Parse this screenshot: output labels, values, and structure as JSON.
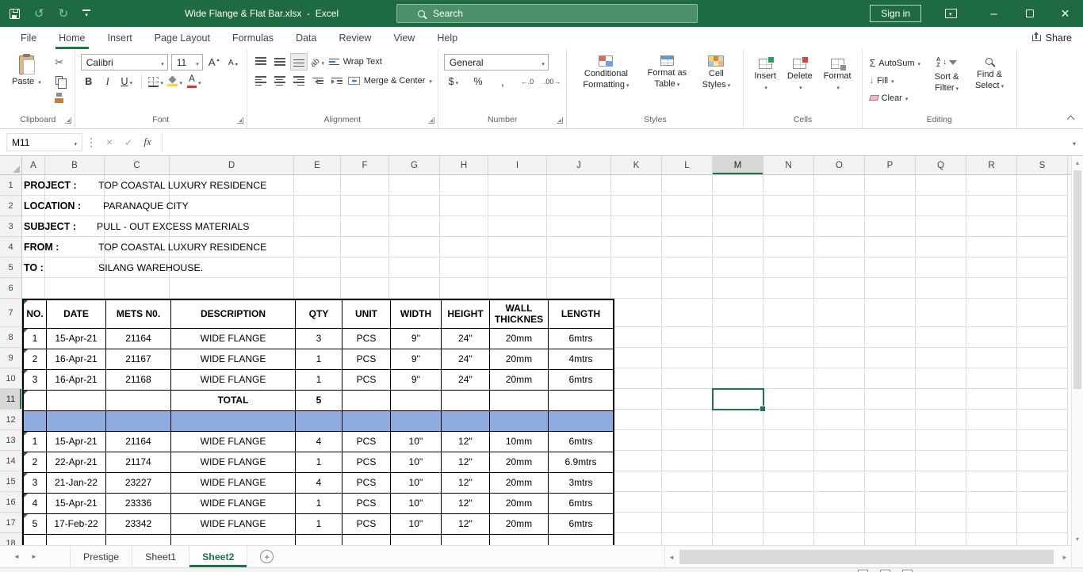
{
  "titlebar": {
    "document_title": "Wide Flange & Flat Bar.xlsx  -  Excel",
    "search_placeholder": "Search",
    "sign_in_label": "Sign in"
  },
  "ribbon": {
    "tabs": [
      "File",
      "Home",
      "Insert",
      "Page Layout",
      "Formulas",
      "Data",
      "Review",
      "View",
      "Help"
    ],
    "active_tab": "Home",
    "share_label": "Share",
    "clipboard": {
      "group_label": "Clipboard",
      "paste_label": "Paste"
    },
    "font": {
      "group_label": "Font",
      "font_name": "Calibri",
      "font_size": "11",
      "bold_label": "B",
      "italic_label": "I",
      "underline_label": "U"
    },
    "alignment": {
      "group_label": "Alignment",
      "wrap_text_label": "Wrap Text",
      "merge_center_label": "Merge & Center"
    },
    "number": {
      "group_label": "Number",
      "format_value": "General",
      "currency_label": "$",
      "percent_label": "%",
      "comma_label": ","
    },
    "styles": {
      "group_label": "Styles",
      "items": [
        "Conditional Formatting",
        "Format as Table",
        "Cell Styles"
      ]
    },
    "cells": {
      "group_label": "Cells",
      "items": [
        "Insert",
        "Delete",
        "Format"
      ]
    },
    "editing": {
      "group_label": "Editing",
      "autosum_label": "AutoSum",
      "fill_label": "Fill",
      "clear_label": "Clear",
      "sort_filter_label": "Sort & Filter",
      "find_select_label": "Find & Select"
    }
  },
  "formula_bar": {
    "name_box_value": "M11",
    "fx_label": "fx",
    "formula_value": ""
  },
  "grid": {
    "columns": [
      "A",
      "B",
      "C",
      "D",
      "E",
      "F",
      "G",
      "H",
      "I",
      "J",
      "K",
      "L",
      "M",
      "N",
      "O",
      "P",
      "Q",
      "R",
      "S"
    ],
    "rows": [
      "1",
      "2",
      "3",
      "4",
      "5",
      "6",
      "7",
      "8",
      "9",
      "10",
      "11",
      "12",
      "13",
      "14",
      "15",
      "16",
      "17",
      "18"
    ],
    "selected_cell": {
      "column": "M",
      "row": "11"
    }
  },
  "sheet": {
    "doc_lines": [
      {
        "label": "PROJECT :",
        "value": "TOP COASTAL LUXURY RESIDENCE"
      },
      {
        "label": "LOCATION :",
        "value": "PARANAQUE CITY"
      },
      {
        "label": "SUBJECT :",
        "value": "PULL - OUT EXCESS MATERIALS"
      },
      {
        "label": "FROM :",
        "value": "TOP COASTAL LUXURY RESIDENCE"
      },
      {
        "label": "TO :",
        "value": "SILANG WAREHOUSE."
      }
    ],
    "table": {
      "headers": [
        "NO.",
        "DATE",
        "METS N0.",
        "DESCRIPTION",
        "QTY",
        "UNIT",
        "WIDTH",
        "HEIGHT",
        "WALL THICKNES",
        "LENGTH"
      ],
      "section1": [
        [
          "1",
          "15-Apr-21",
          "21164",
          "WIDE FLANGE",
          "3",
          "PCS",
          "9''",
          "24''",
          "20mm",
          "6mtrs"
        ],
        [
          "2",
          "16-Apr-21",
          "21167",
          "WIDE FLANGE",
          "1",
          "PCS",
          "9''",
          "24''",
          "20mm",
          "4mtrs"
        ],
        [
          "3",
          "16-Apr-21",
          "21168",
          "WIDE FLANGE",
          "1",
          "PCS",
          "9''",
          "24''",
          "20mm",
          "6mtrs"
        ]
      ],
      "total_label": "TOTAL",
      "total_qty": "5",
      "section2": [
        [
          "1",
          "15-Apr-21",
          "21164",
          "WIDE FLANGE",
          "4",
          "PCS",
          "10''",
          "12''",
          "10mm",
          "6mtrs"
        ],
        [
          "2",
          "22-Apr-21",
          "21174",
          "WIDE FLANGE",
          "1",
          "PCS",
          "10''",
          "12''",
          "20mm",
          "6.9mtrs"
        ],
        [
          "3",
          "21-Jan-22",
          "23227",
          "WIDE FLANGE",
          "4",
          "PCS",
          "10''",
          "12''",
          "20mm",
          "3mtrs"
        ],
        [
          "4",
          "15-Apr-21",
          "23336",
          "WIDE FLANGE",
          "1",
          "PCS",
          "10''",
          "12''",
          "20mm",
          "6mtrs"
        ],
        [
          "5",
          "17-Feb-22",
          "23342",
          "WIDE FLANGE",
          "1",
          "PCS",
          "10''",
          "12''",
          "20mm",
          "6mtrs"
        ]
      ]
    }
  },
  "sheet_tabs": {
    "tabs": [
      "Prestige",
      "Sheet1",
      "Sheet2"
    ],
    "active_tab": "Sheet2"
  }
}
